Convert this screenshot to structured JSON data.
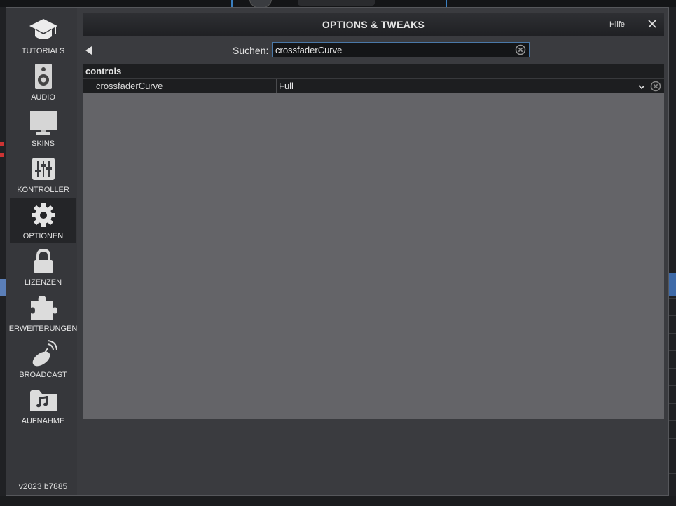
{
  "window": {
    "title": "OPTIONS & TWEAKS",
    "help_label": "Hilfe"
  },
  "sidebar": {
    "items": [
      {
        "label": "TUTORIALS",
        "icon": "graduation-cap-icon"
      },
      {
        "label": "AUDIO",
        "icon": "speaker-icon"
      },
      {
        "label": "SKINS",
        "icon": "monitor-icon"
      },
      {
        "label": "KONTROLLER",
        "icon": "mixer-sliders-icon"
      },
      {
        "label": "OPTIONEN",
        "icon": "gear-icon",
        "active": true
      },
      {
        "label": "LIZENZEN",
        "icon": "lock-icon"
      },
      {
        "label": "ERWEITERUNGEN",
        "icon": "puzzle-icon"
      },
      {
        "label": "BROADCAST",
        "icon": "satellite-dish-icon"
      },
      {
        "label": "AUFNAHME",
        "icon": "music-folder-icon"
      }
    ],
    "version": "v2023 b7885"
  },
  "search": {
    "label": "Suchen:",
    "value": "crossfaderCurve"
  },
  "options": {
    "group": "controls",
    "rows": [
      {
        "name": "crossfaderCurve",
        "value": "Full"
      }
    ]
  },
  "colors": {
    "accent": "#4a78a8",
    "panel": "#646468",
    "header": "#1d1e20"
  }
}
